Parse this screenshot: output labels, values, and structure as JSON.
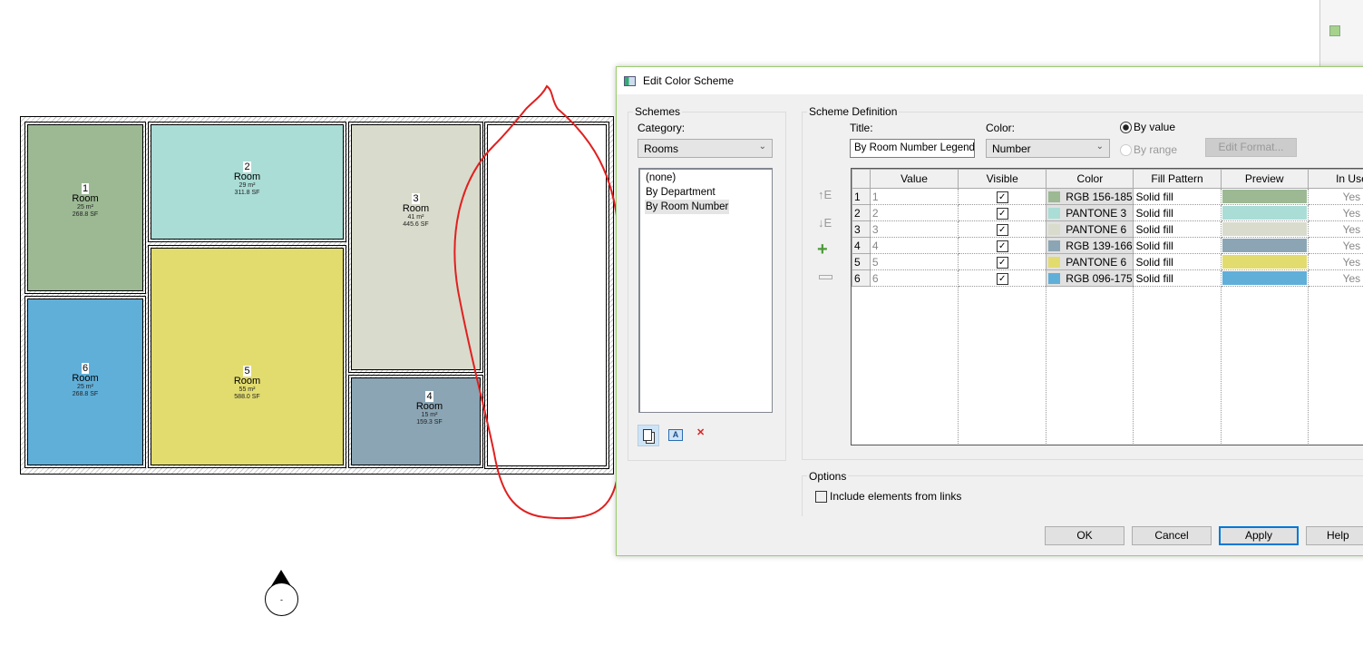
{
  "plan": {
    "rooms": [
      {
        "number": "1",
        "name": "Room",
        "area_m": "25 m²",
        "area_sf": "268.8 SF",
        "color": "#9cb994"
      },
      {
        "number": "2",
        "name": "Room",
        "area_m": "29 m²",
        "area_sf": "311.8 SF",
        "color": "#aaddd6"
      },
      {
        "number": "3",
        "name": "Room",
        "area_m": "41 m²",
        "area_sf": "445.6 SF",
        "color": "#d9dbcc"
      },
      {
        "number": "4",
        "name": "Room",
        "area_m": "15 m²",
        "area_sf": "159.3 SF",
        "color": "#8ba5b4"
      },
      {
        "number": "5",
        "name": "Room",
        "area_m": "55 m²",
        "area_sf": "588.0 SF",
        "color": "#e2dc6f"
      },
      {
        "number": "6",
        "name": "Room",
        "area_m": "25 m²",
        "area_sf": "268.8 SF",
        "color": "#60afd9"
      }
    ],
    "marker_label": "-"
  },
  "dialog": {
    "title": "Edit Color Scheme",
    "schemes": {
      "group": "Schemes",
      "category_label": "Category:",
      "category_value": "Rooms",
      "items": [
        "(none)",
        "By Department",
        "By Room Number"
      ],
      "selected": 2
    },
    "definition": {
      "group": "Scheme Definition",
      "title_label": "Title:",
      "title_value": "By Room Number Legend",
      "color_label": "Color:",
      "color_value": "Number",
      "by_value": "By value",
      "by_range": "By range",
      "edit_format": "Edit Format..."
    },
    "table": {
      "headers": [
        "Value",
        "Visible",
        "Color",
        "Fill Pattern",
        "Preview",
        "In Use"
      ],
      "rows": [
        {
          "idx": "1",
          "value": "1",
          "color": "RGB 156-185",
          "swatch": "#9cb994",
          "fill": "Solid fill",
          "in_use": "Yes"
        },
        {
          "idx": "2",
          "value": "2",
          "color": "PANTONE 3",
          "swatch": "#aaddd6",
          "fill": "Solid fill",
          "in_use": "Yes"
        },
        {
          "idx": "3",
          "value": "3",
          "color": "PANTONE 6",
          "swatch": "#d9dbcc",
          "fill": "Solid fill",
          "in_use": "Yes"
        },
        {
          "idx": "4",
          "value": "4",
          "color": "RGB 139-166",
          "swatch": "#8ba5b4",
          "fill": "Solid fill",
          "in_use": "Yes"
        },
        {
          "idx": "5",
          "value": "5",
          "color": "PANTONE 6",
          "swatch": "#e2dc6f",
          "fill": "Solid fill",
          "in_use": "Yes"
        },
        {
          "idx": "6",
          "value": "6",
          "color": "RGB 096-175",
          "swatch": "#60afd9",
          "fill": "Solid fill",
          "in_use": "Yes"
        }
      ]
    },
    "options": {
      "group": "Options",
      "include_links": "Include elements from links"
    },
    "buttons": {
      "ok": "OK",
      "cancel": "Cancel",
      "apply": "Apply",
      "help": "Help"
    }
  }
}
